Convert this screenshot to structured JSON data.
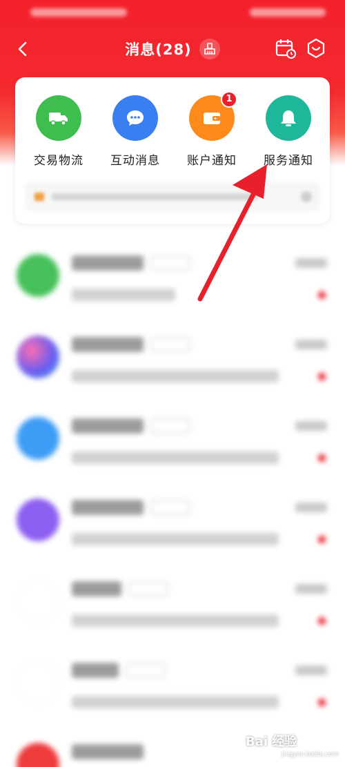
{
  "nav": {
    "title": "消息(28)",
    "back_icon": "chevron-left-icon",
    "clean_icon": "broom-icon",
    "calendar_icon": "calendar-clock-icon",
    "settings_icon": "hexagon-settings-icon"
  },
  "quick_entries": [
    {
      "label": "交易物流",
      "icon": "truck-icon",
      "color": "#3fbd4f"
    },
    {
      "label": "互动消息",
      "icon": "chat-bubble-icon",
      "color": "#3a7ff2"
    },
    {
      "label": "账户通知",
      "icon": "wallet-icon",
      "color": "#ff8a1c",
      "badge": "1"
    },
    {
      "label": "服务通知",
      "icon": "bell-icon",
      "color": "#1fb79a"
    }
  ],
  "conversations": [
    {
      "avatar_color": "#46c05a",
      "unread": true
    },
    {
      "avatar_color": "#8a5cf0",
      "unread": true
    },
    {
      "avatar_color": "#3d9cf5",
      "unread": true
    },
    {
      "avatar_color": "#8d5ff2",
      "unread": true
    },
    {
      "avatar_color": "#ffffff",
      "unread": true
    },
    {
      "avatar_color": "#ffffff",
      "unread": true
    },
    {
      "avatar_color": "#ee3b3b",
      "unread": false
    }
  ],
  "annotation": {
    "arrow_color": "#e8202c"
  },
  "watermark": {
    "text": "Bai 经验",
    "sub": "jingyan.baidu.com"
  },
  "theme": {
    "primary": "#f3202b"
  }
}
